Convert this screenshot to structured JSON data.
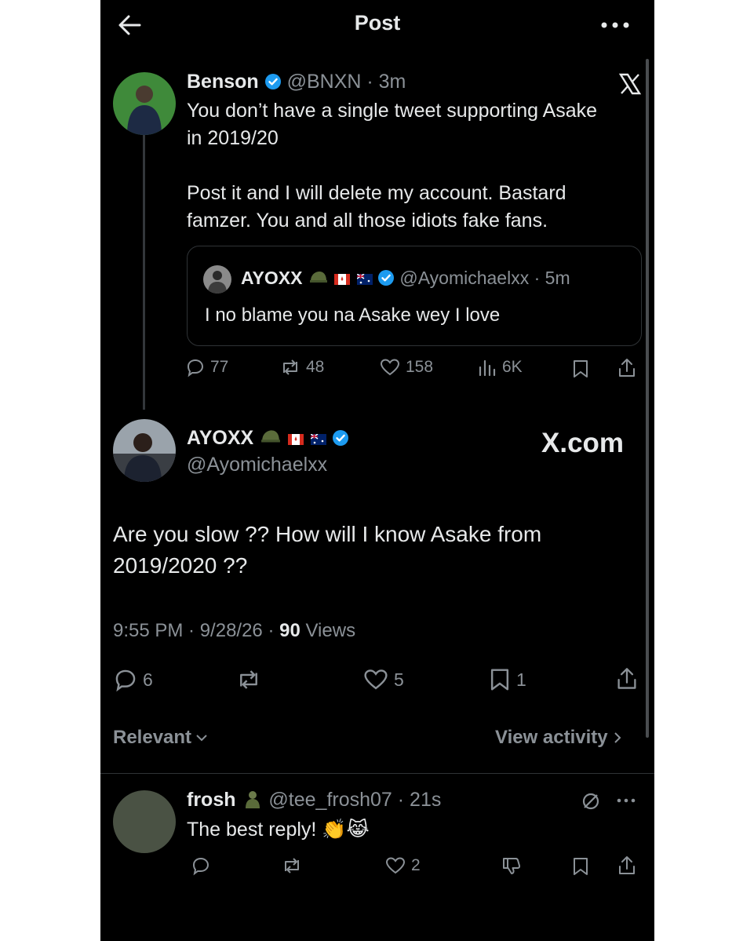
{
  "topbar": {
    "title": "Post",
    "back_icon": "arrow-left-icon",
    "more_icon": "more-horizontal-icon"
  },
  "parent_post": {
    "author_name": "Benson",
    "handle": "@BNXN",
    "time": "3m",
    "text_line1": "You don’t have a single tweet supporting Asake",
    "text_line2": "in 2019/20",
    "text_line3": "Post it and I will delete my account. Bastard",
    "text_line4": "famzer. You and all those idiots fake fans.",
    "quote": {
      "author_name": "AYOXX",
      "handle": "@Ayomichaelxx",
      "time": "5m",
      "text": "I no blame you na Asake wey I love"
    },
    "stats": {
      "replies": "77",
      "reposts": "48",
      "likes": "158",
      "views": "6K"
    }
  },
  "main_post": {
    "author_name": "AYOXX",
    "handle": "@Ayomichaelxx",
    "watermark": "X.com",
    "text_line1": "Are you slow ?? How will I know Asake from",
    "text_line2": "2019/2020 ??",
    "timestamp": "9:55 PM · 9/28/26 · ",
    "views_count": "90",
    "views_label": " Views",
    "stats": {
      "replies": "6",
      "likes": "5",
      "bookmarks": "1"
    }
  },
  "sort": {
    "label": "Relevant",
    "view_activity": "View activity"
  },
  "reply": {
    "author_name": "frosh",
    "handle": "@tee_frosh07",
    "time": "21s",
    "text": "The best reply!",
    "emojis": "👏😹",
    "likes": "2"
  },
  "colors": {
    "background": "#000000",
    "text": "#e7e9ea",
    "secondary": "#8b9197",
    "verified": "#1d9bf0",
    "border": "#2f3336"
  }
}
